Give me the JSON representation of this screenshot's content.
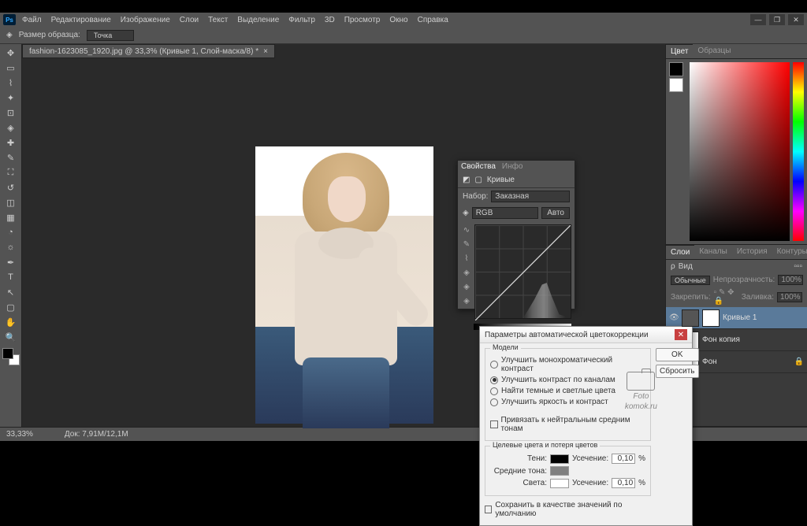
{
  "menu": [
    "Файл",
    "Редактирование",
    "Изображение",
    "Слои",
    "Текст",
    "Выделение",
    "Фильтр",
    "3D",
    "Просмотр",
    "Окно",
    "Справка"
  ],
  "optbar": {
    "label": "Размер образца:",
    "value": "Точка"
  },
  "doctab": "fashion-1623085_1920.jpg @ 33,3% (Кривые 1, Слой-маска/8) *",
  "status": {
    "zoom": "33,33%",
    "doc": "Док: 7,91M/12,1M"
  },
  "colorTabs": [
    "Цвет",
    "Образцы"
  ],
  "layersTabs": [
    "Слои",
    "Каналы",
    "История",
    "Контуры"
  ],
  "layers": {
    "kind": "Вид",
    "blend": "Обычные",
    "opacityLbl": "Непрозрачность:",
    "opacity": "100%",
    "lockLbl": "Закрепить:",
    "fillLbl": "Заливка:",
    "fill": "100%",
    "items": [
      {
        "name": "Кривые 1",
        "sel": true
      },
      {
        "name": "Фон копия",
        "sel": false
      },
      {
        "name": "Фон",
        "sel": false
      }
    ]
  },
  "curves": {
    "tabs": [
      "Свойства",
      "Инфо"
    ],
    "title": "Кривые",
    "presetLbl": "Набор:",
    "preset": "Заказная",
    "channel": "RGB",
    "auto": "Авто"
  },
  "dialog": {
    "title": "Параметры автоматической цветокоррекции",
    "ok": "OK",
    "cancel": "Сбросить",
    "grp1": "Модели",
    "radios": [
      "Улучшить монохроматический контраст",
      "Улучшить контраст по каналам",
      "Найти темные и светлые цвета",
      "Улучшить яркость и контраст"
    ],
    "radioSel": 1,
    "neutral": "Привязать к нейтральным средним тонам",
    "grp2": "Целевые цвета и потеря цветов",
    "shadows": "Тени:",
    "mid": "Средние тона:",
    "high": "Света:",
    "clip": "Усечение:",
    "clipval": "0,10",
    "pct": "%",
    "save": "Сохранить в качестве значений по умолчанию"
  },
  "watermark": {
    "l1": "Foto",
    "l2": "komok.ru"
  }
}
